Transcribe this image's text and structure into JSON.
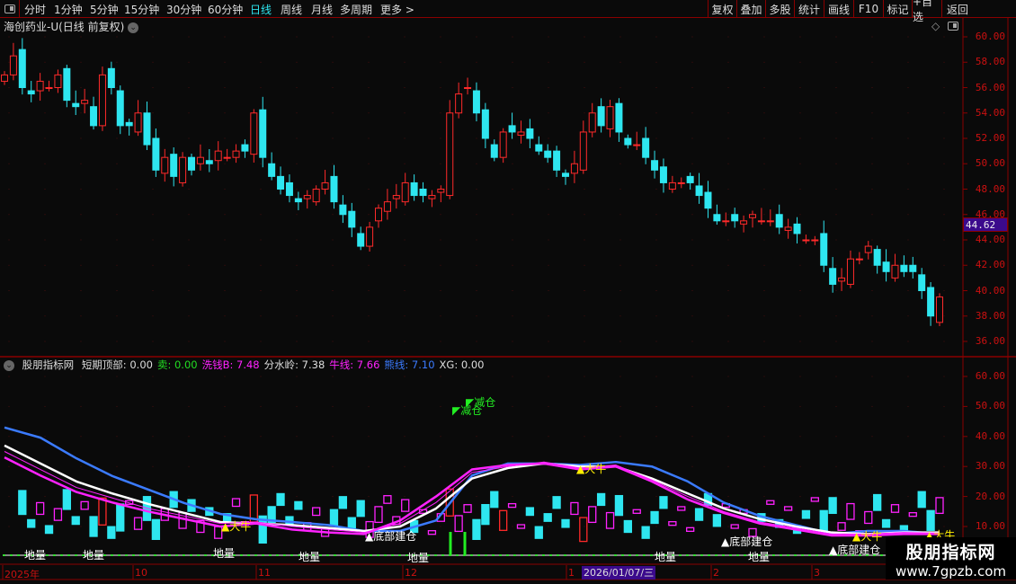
{
  "toolbar": {
    "periods": [
      "分时",
      "1分钟",
      "5分钟",
      "15分钟",
      "30分钟",
      "60分钟",
      "日线",
      "周线",
      "月线",
      "多周期",
      "更多 >"
    ],
    "active_period": "日线",
    "buttons": [
      "复权",
      "叠加",
      "多股",
      "统计",
      "画线",
      "F10",
      "标记",
      "+自选",
      "返回"
    ]
  },
  "chart": {
    "title": "海创药业-U(日线 前复权)",
    "current_price": "44.62",
    "price_ticks": [
      "60.00",
      "58.00",
      "56.00",
      "54.00",
      "52.00",
      "50.00",
      "48.00",
      "46.00",
      "44.00",
      "42.00",
      "40.00",
      "38.00",
      "36.00"
    ],
    "closes": [
      57,
      58.5,
      56,
      55.5,
      56.5,
      56,
      57,
      55,
      54.5,
      55,
      53,
      57,
      56,
      53,
      53,
      54,
      51.5,
      49.5,
      50.5,
      49,
      50.5,
      49.5,
      50.5,
      50,
      51,
      50.5,
      51,
      51,
      54,
      50.5,
      49,
      48,
      47.5,
      47,
      47.5,
      48,
      48.5,
      47,
      46,
      45,
      43.5,
      45,
      46.5,
      47,
      47.5,
      48.5,
      47.5,
      47.5,
      47.5,
      48,
      54,
      55.5,
      56,
      54,
      52,
      50.5,
      52.5,
      52.5,
      52.5,
      52,
      51,
      50.5,
      49.5,
      49,
      50,
      52.5,
      54,
      53,
      54.5,
      52.5,
      51.5,
      51.5,
      50.5,
      49.5,
      48.5,
      48.5,
      48.5,
      48.5,
      47.5,
      46.5,
      45.5,
      45.5,
      45.5,
      45.5,
      46,
      45.5,
      45.5,
      45,
      45,
      44.5,
      44,
      44,
      42,
      40.5,
      41,
      42.5,
      42.5,
      43.5,
      42,
      41.5,
      42,
      41.5,
      41.5,
      40,
      38,
      39.5
    ],
    "colors": {
      "up": "#ff2a2a",
      "down": "#2ee6f0"
    }
  },
  "indicator": {
    "name": "股朋指标网",
    "fields": [
      {
        "label": "短期顶部: 0.00",
        "color": "#dddddd"
      },
      {
        "label": "卖: 0.00",
        "color": "#22dd22"
      },
      {
        "label": "洗钱B: 7.48",
        "color": "#ff22ff"
      },
      {
        "label": "分水岭: 7.38",
        "color": "#dddddd"
      },
      {
        "label": "牛线: 7.66",
        "color": "#ff22ff"
      },
      {
        "label": "熊线: 7.10",
        "color": "#3b7bff"
      },
      {
        "label": "XG: 0.00",
        "color": "#dddddd"
      }
    ],
    "ticks": [
      "60.00",
      "50.00",
      "40.00",
      "30.00",
      "20.00",
      "10.00"
    ],
    "series": {
      "bear": [
        43,
        39.6,
        32.7,
        26.8,
        22.3,
        17.8,
        14.2,
        12.4,
        11.5,
        10.5,
        8.5,
        8.5,
        12,
        27,
        31,
        31,
        30.5,
        31.5,
        30,
        25,
        18,
        13.5,
        10.5,
        7.5,
        8.5,
        8.5,
        7.5
      ],
      "divide": [
        37,
        31,
        25,
        21,
        17.5,
        14.5,
        11.5,
        11,
        10.5,
        9.5,
        8.5,
        10,
        16,
        26,
        29.5,
        31,
        30,
        30,
        26,
        21,
        16,
        12.5,
        10,
        8,
        7.5,
        8,
        8
      ],
      "bull": [
        33,
        27,
        21.5,
        18,
        15,
        12.5,
        10,
        11,
        9,
        8,
        7.5,
        12,
        20,
        29,
        30.5,
        31,
        29,
        30,
        25,
        19,
        14.5,
        11,
        9,
        7,
        7,
        7.5,
        7.5
      ],
      "wash": [
        35,
        29,
        23,
        19.5,
        16,
        13.5,
        11,
        11.5,
        10,
        9,
        8,
        11,
        18,
        28,
        30,
        31.5,
        29.5,
        30.5,
        25.5,
        20,
        15,
        11.5,
        9.5,
        7.5,
        7.5,
        8,
        7.8
      ]
    },
    "signals": {
      "low_volume": "地量",
      "bottom_build": "底部建仓",
      "big_bull": "大牛",
      "reduce": "减仓"
    }
  },
  "date_axis": {
    "labels": [
      "2025年",
      "10",
      "11",
      "12",
      "1",
      "2",
      "3"
    ],
    "cursor_date": "2026/01/07/三"
  },
  "watermark": {
    "title": "股朋指标网",
    "url": "www.7gpzb.com"
  }
}
